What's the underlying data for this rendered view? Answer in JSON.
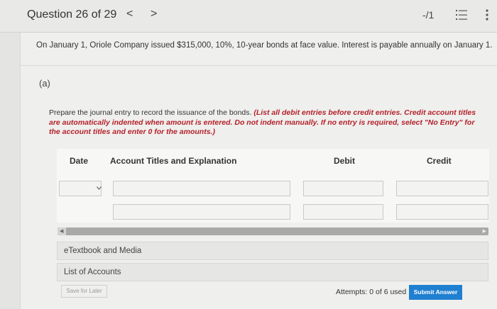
{
  "header": {
    "question_label": "Question 26 of 29",
    "prev_symbol": "<",
    "next_symbol": ">",
    "score": "-/1",
    "icons": [
      "chevron-left-icon",
      "chevron-right-icon",
      "list-icon",
      "more-vertical-icon"
    ]
  },
  "question": {
    "intro": "On January 1, Oriole Company issued $315,000, 10%, 10-year bonds at face value. Interest is payable annually on January 1.",
    "part_label": "(a)",
    "instruction_plain": "Prepare the journal entry to record the issuance of the bonds. ",
    "instruction_emphasis": "(List all debit entries before credit entries. Credit account titles are automatically indented when amount is entered. Do not indent manually. If no entry is required, select \"No Entry\" for the account titles and enter 0 for the amounts.)"
  },
  "journal": {
    "columns": {
      "date": "Date",
      "account": "Account Titles and Explanation",
      "debit": "Debit",
      "credit": "Credit"
    },
    "rows": [
      {
        "date": "",
        "account": "",
        "debit": "",
        "credit": ""
      },
      {
        "account": "",
        "debit": "",
        "credit": ""
      }
    ]
  },
  "resources": {
    "etextbook": "eTextbook and Media",
    "list_of_accounts": "List of Accounts"
  },
  "footer": {
    "save_label": "Save for Later",
    "attempts": "Attempts: 0 of 6 used",
    "submit_label": "Submit Answer"
  },
  "colors": {
    "accent": "#1f7fd0",
    "emphasis": "#b4202a"
  }
}
